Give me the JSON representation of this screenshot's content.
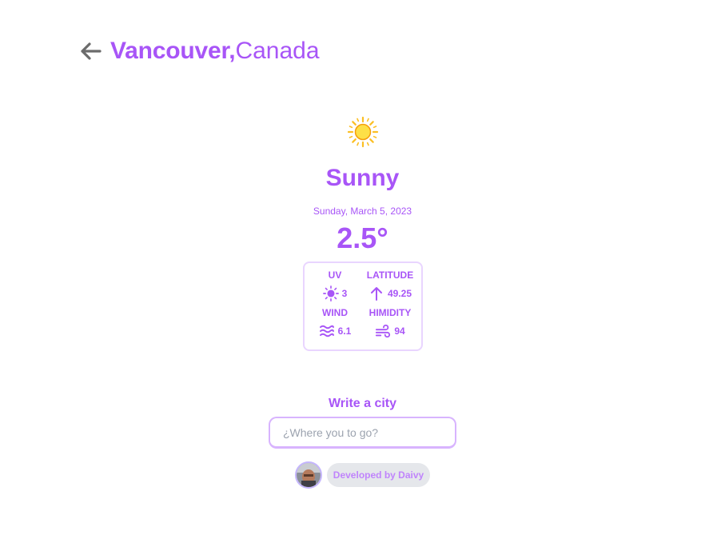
{
  "header": {
    "city": "Vancouver,",
    "country": "Canada"
  },
  "weather": {
    "icon": "sun-icon",
    "condition": "Sunny",
    "date": "Sunday, March 5, 2023",
    "temperature": "2.5°"
  },
  "stats": {
    "uv": {
      "label": "UV",
      "value": "3",
      "icon": "sun-small-icon"
    },
    "latitude": {
      "label": "LATITUDE",
      "value": "49.25",
      "icon": "arrow-up-icon"
    },
    "wind": {
      "label": "WIND",
      "value": "6.1",
      "icon": "waves-icon"
    },
    "humidity": {
      "label": "HIMIDITY",
      "value": "94",
      "icon": "wind-icon"
    }
  },
  "search": {
    "label": "Write a city",
    "placeholder": "¿Where you to go?",
    "value": ""
  },
  "credit": {
    "text": "Developed by Daivy"
  },
  "colors": {
    "accent": "#a855f7",
    "border": "#e9d5ff",
    "pill": "#e5e7eb"
  }
}
